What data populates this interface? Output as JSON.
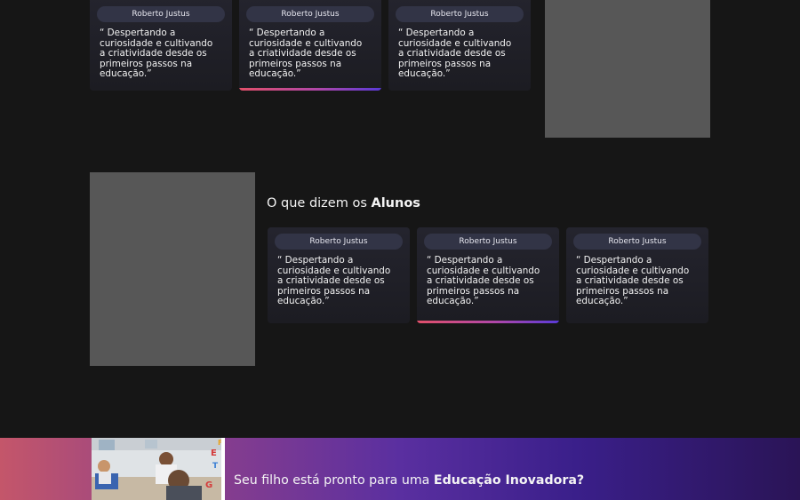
{
  "top_testimonials": [
    {
      "author": "Roberto Justus",
      "quote": "“ Despertando a curiosidade e cultivando a criatividade desde os primeiros passos na educação.”",
      "active": false
    },
    {
      "author": "Roberto Justus",
      "quote": "“ Despertando a curiosidade e cultivando a criatividade desde os primeiros passos na educação.”",
      "active": true
    },
    {
      "author": "Roberto Justus",
      "quote": "“ Despertando a curiosidade e cultivando a criatividade desde os primeiros passos na educação.”",
      "active": false
    }
  ],
  "students_section": {
    "title_prefix": "O que dizem os",
    "title_highlight": "Alunos",
    "testimonials": [
      {
        "author": "Roberto Justus",
        "quote": "“ Despertando a curiosidade e cultivando a criatividade desde os primeiros passos na educação.”",
        "active": false
      },
      {
        "author": "Roberto Justus",
        "quote": "“ Despertando a curiosidade e cultivando a criatividade desde os primeiros passos na educação.”",
        "active": true
      },
      {
        "author": "Roberto Justus",
        "quote": "“ Despertando a curiosidade e cultivando a criatividade desde os primeiros passos na educação.”",
        "active": false
      }
    ]
  },
  "cta": {
    "text_prefix": "Seu filho está pronto para uma",
    "text_highlight": "Educação Inovadora?"
  },
  "colors": {
    "background": "#161616",
    "card": "#24242e",
    "author_pill": "#323446",
    "placeholder": "#575757",
    "accent_start": "#e2506a",
    "accent_end": "#5a3ad8"
  }
}
